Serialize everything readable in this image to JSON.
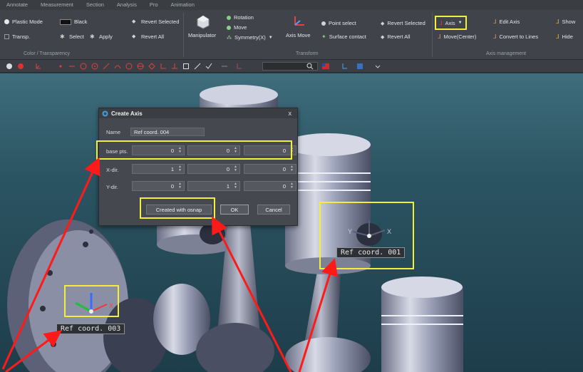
{
  "menu": [
    "Annotate",
    "Measurement",
    "Section",
    "Analysis",
    "Pro",
    "Animation"
  ],
  "ribbon": {
    "color_group": {
      "plastic_mode": "Plastic Mode",
      "transp": "Transp.",
      "color_name": "Black",
      "select": "Select",
      "apply": "Apply",
      "revert_selected": "Revert Selected",
      "revert_all": "Revert All",
      "label": "Color / Transparency"
    },
    "transform_group": {
      "manipulator": "Manipulator",
      "rotation": "Rotation",
      "move": "Move",
      "symmetry": "Symmetry(X)",
      "axis_move": "Axis Move",
      "point_select": "Point select",
      "surface_contact": "Surface contact",
      "revert_selected": "Revert Selected",
      "revert_all": "Revert All",
      "label": "Transform"
    },
    "axis_group": {
      "axis": "Axis",
      "move_center": "Move(Center)",
      "edit_axis": "Edit Axis",
      "convert_to_lines": "Convert to Lines",
      "show": "Show",
      "hide": "Hide",
      "label": "Axis management"
    }
  },
  "dialog": {
    "title": "Create Axis",
    "close": "x",
    "name_label": "Name",
    "name_value": "Ref coord. 004",
    "rows": [
      {
        "label": "base pts.",
        "values": [
          "0",
          "0",
          "0"
        ]
      },
      {
        "label": "X-dir.",
        "values": [
          "1",
          "0",
          "0"
        ]
      },
      {
        "label": "Y-dir.",
        "values": [
          "0",
          "1",
          "0"
        ]
      }
    ],
    "osnap_button": "Created with osnap",
    "ok_button": "OK",
    "cancel_button": "Cancel"
  },
  "viewport": {
    "labels": [
      "Ref coord. 001",
      "Ref coord. 003"
    ],
    "axis_letters": {
      "x": "X",
      "y": "Y"
    }
  },
  "colors": {
    "highlight": "#f2ee3a",
    "arrow": "#ff1a1a",
    "ribbon_bg": "#404349"
  }
}
